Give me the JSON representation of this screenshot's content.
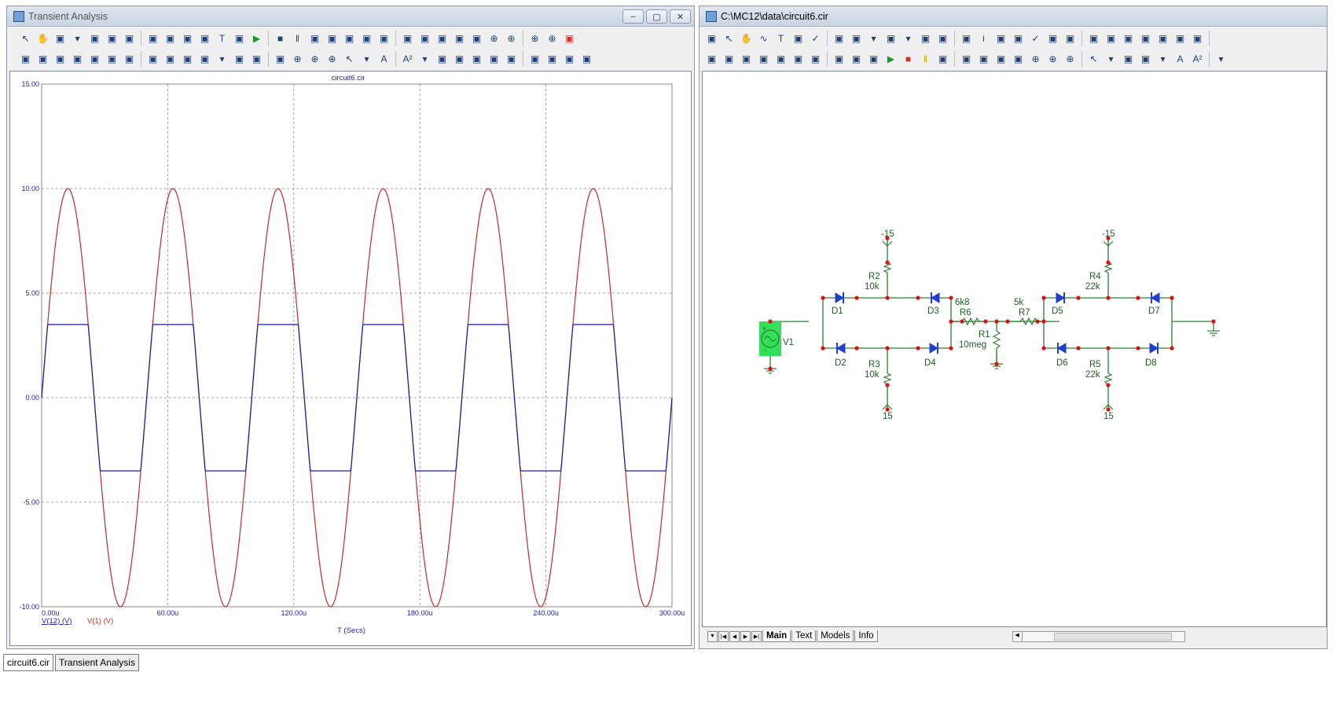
{
  "left_window": {
    "title": "Transient Analysis",
    "toolbar1_icons": [
      "select-icon",
      "pan-icon",
      "component-icon",
      "dropdown-icon",
      "open-icon",
      "image-icon",
      "image2-icon",
      "fit-icon",
      "fit2-icon",
      "fit3-icon",
      "fx-icon",
      "text-tool-icon",
      "properties-icon",
      "run-icon",
      "stop-icon",
      "pause-icon",
      "scale-icon",
      "scale2-icon",
      "cursor-icon",
      "grid-icon",
      "layout-icon",
      "layout2-icon",
      "layout3-icon",
      "layout4-icon",
      "split-icon",
      "split2-icon",
      "zoom-in-icon",
      "zoom-out-icon",
      "zoom-fit-icon",
      "zoom-area-icon",
      "close-red-icon"
    ],
    "toolbar2_icons": [
      "peak-icon",
      "valley-icon",
      "high-icon",
      "low-icon",
      "inflection-icon",
      "global-high-icon",
      "global-low-icon",
      "top-icon",
      "bottom-icon",
      "slope-icon",
      "clipboard-icon",
      "dropdown-icon",
      "data-icon",
      "tokens-icon",
      "trace-icon",
      "zoom-in-icon",
      "zoom-out-icon",
      "zoom-fit-icon",
      "grid-select-icon",
      "dropdown-icon",
      "font-icon",
      "font-size-icon",
      "dropdown-icon",
      "copy-icon",
      "paste-icon",
      "paste2-icon",
      "align-left-icon",
      "align-center-icon",
      "align-right-icon",
      "align-top-icon",
      "align-middle-icon",
      "align-bottom-icon"
    ]
  },
  "right_window": {
    "title": "C:\\MC12\\data\\circuit6.cir",
    "toolbar1_icons": [
      "pen-icon",
      "select-icon",
      "pan-icon",
      "wire-icon",
      "text-tool-icon",
      "line-icon",
      "check-icon",
      "bus-icon",
      "component-icon",
      "dropdown-icon",
      "node-icon",
      "dropdown-icon",
      "window-icon",
      "table-icon",
      "pin-icon",
      "info-icon",
      "tool-icon",
      "probe-icon",
      "checkbox-icon",
      "list-icon",
      "list2-icon",
      "grid-icon",
      "mirror-icon",
      "mirror2-icon",
      "attrib-icon",
      "attrib2-icon",
      "attrib3-icon",
      "tools-icon"
    ],
    "toolbar2_icons": [
      "area-icon",
      "rect-icon",
      "rotate-icon",
      "flip-icon",
      "flip2-icon",
      "find-icon",
      "find2-icon",
      "page-icon",
      "page2-icon",
      "edit-icon",
      "go-green-icon",
      "stop-red-icon",
      "pause-yellow-icon",
      "copy-icon",
      "paste-icon",
      "folder-icon",
      "new-icon",
      "delete-icon",
      "zoom-in-icon",
      "zoom-out-icon",
      "zoom-fit-icon",
      "arrow-icon",
      "dropdown-icon",
      "image-icon",
      "palette-icon",
      "dropdown-icon",
      "font-icon",
      "font-size-icon",
      "dropdown-icon"
    ],
    "page_tabs": [
      "Main",
      "Text",
      "Models",
      "Info"
    ]
  },
  "chart_data": {
    "type": "line",
    "title": "circuit6.cir",
    "xlabel": "T (Secs)",
    "xlim": [
      0,
      300
    ],
    "ylim": [
      -10,
      15
    ],
    "x_tick_labels": [
      "0.00u",
      "60.00u",
      "120.00u",
      "180.00u",
      "240.00u",
      "300.00u"
    ],
    "y_tick_labels": [
      "15.00",
      "10.00",
      "5.00",
      "0.00",
      "-5.00",
      "-10.00"
    ],
    "grid": true,
    "series": [
      {
        "name": "V(12) (V)",
        "color": "#1c1ca8",
        "description": "sine clipped",
        "amplitude": 10,
        "clip": 3.5,
        "period_us": 50
      },
      {
        "name": "V(1) (V)",
        "color": "#c62828",
        "amplitude": 10,
        "period_us": 50
      }
    ]
  },
  "schematic": {
    "labels": {
      "m15a": "-15",
      "m15b": "-15",
      "p15a": "15",
      "p15b": "15",
      "r2": "R2",
      "r2v": "10k",
      "r3": "R3",
      "r3v": "10k",
      "r4": "R4",
      "r4v": "22k",
      "r5": "R5",
      "r5v": "22k",
      "r6v": "6k8",
      "r6": "R6",
      "r7v": "5k",
      "r7": "R7",
      "r1": "R1",
      "r1v": "10meg",
      "v1": "V1",
      "d1": "D1",
      "d2": "D2",
      "d3": "D3",
      "d4": "D4",
      "d5": "D5",
      "d6": "D6",
      "d7": "D7",
      "d8": "D8"
    }
  },
  "taskbar": {
    "items": [
      "circuit6.cir",
      "Transient Analysis"
    ]
  }
}
